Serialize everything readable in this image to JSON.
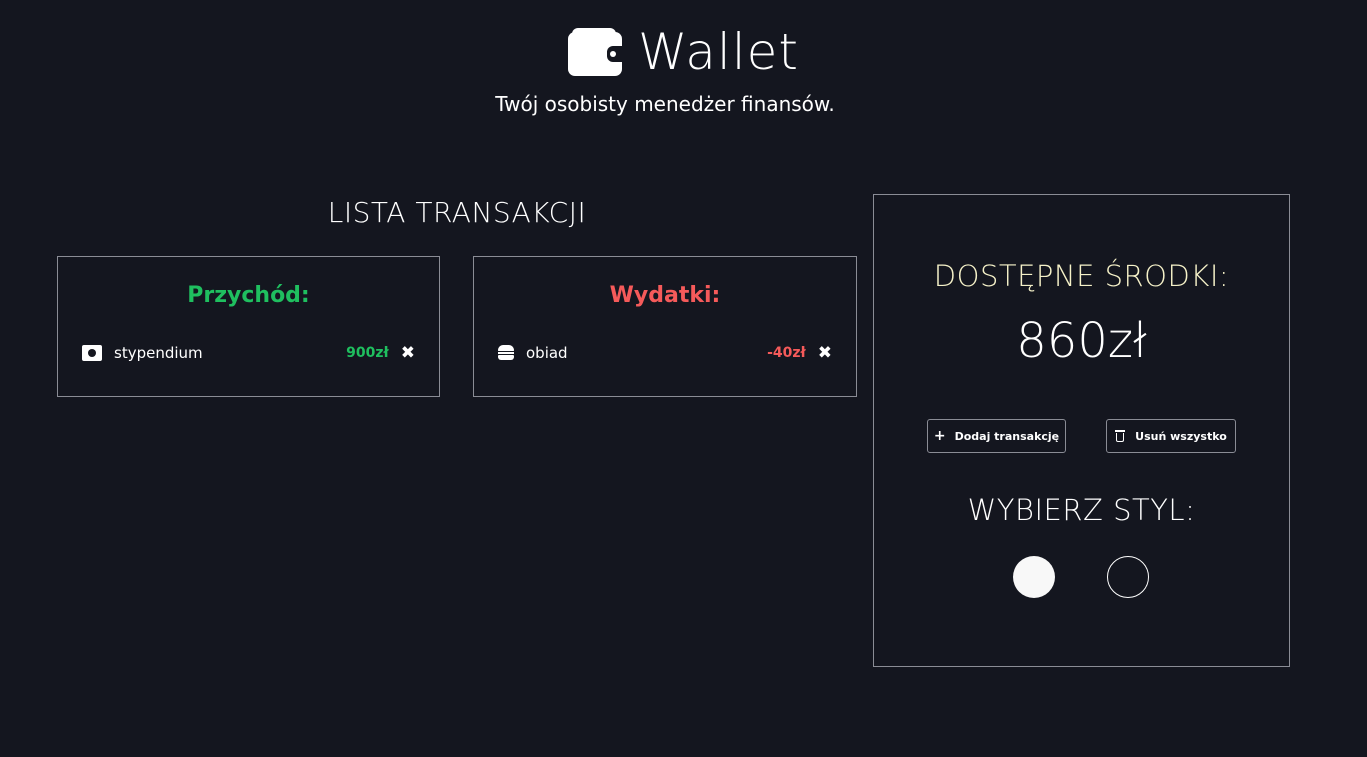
{
  "app": {
    "title": "Wallet",
    "subtitle": "Twój osobisty menedżer finansów.",
    "icon": "wallet-icon"
  },
  "transactions": {
    "title": "LISTA TRANSAKCJI",
    "income": {
      "heading": "Przychód:",
      "color": "#1fbf5f",
      "items": [
        {
          "icon": "money-icon",
          "name": "stypendium",
          "amount": "900zł",
          "delete": "✖"
        }
      ]
    },
    "expenses": {
      "heading": "Wydatki:",
      "color": "#f55a5a",
      "items": [
        {
          "icon": "burger-icon",
          "name": "obiad",
          "amount": "-40zł",
          "delete": "✖"
        }
      ]
    }
  },
  "balance": {
    "title": "DOSTĘPNE ŚRODKI:",
    "amount": "860zł",
    "add_button": "Dodaj transakcję",
    "delete_all_button": "Usuń wszystko",
    "add_icon": "plus-icon",
    "delete_icon": "trash-icon"
  },
  "style": {
    "title": "WYBIERZ STYL:",
    "options": [
      {
        "name": "light",
        "color": "#f8f8f8"
      },
      {
        "name": "dark",
        "color": "#14161f"
      }
    ]
  }
}
